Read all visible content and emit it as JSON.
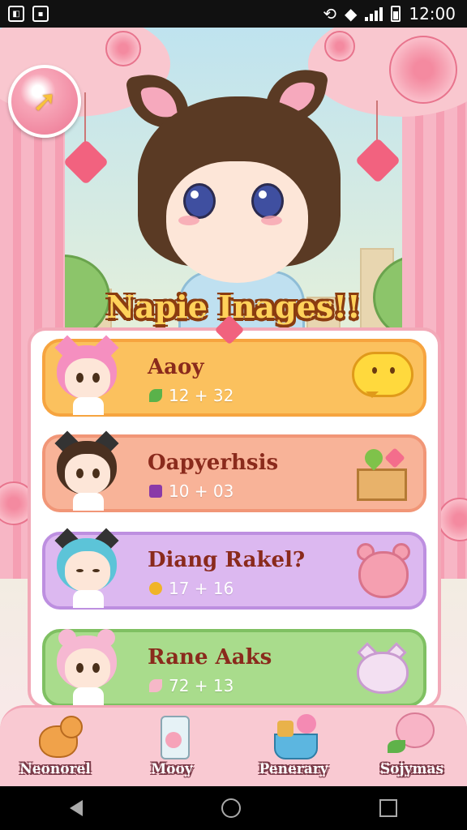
{
  "status_bar": {
    "time": "12:00"
  },
  "title": "Napie Inages!!",
  "characters": [
    {
      "name": "Aaoy",
      "stat": "12 + 32",
      "theme": "#fbc15e",
      "hair": "#f58fc0"
    },
    {
      "name": "Oapyerhsis",
      "stat": "10 + 03",
      "theme": "#f8b398",
      "hair": "#4a3020"
    },
    {
      "name": "Diang Rakel?",
      "stat": "17 + 16",
      "theme": "#dcb8f0",
      "hair": "#5cc4d8"
    },
    {
      "name": "Rane Aaks",
      "stat": "72 + 13",
      "theme": "#a9dc8c",
      "hair": "#f6b8d2"
    }
  ],
  "tabs": [
    {
      "label": "Neonorel",
      "icon": "cat-icon"
    },
    {
      "label": "Mooy",
      "icon": "jar-icon"
    },
    {
      "label": "Penerary",
      "icon": "basket-icon"
    },
    {
      "label": "Sojymas",
      "icon": "flower-friend-icon"
    }
  ]
}
